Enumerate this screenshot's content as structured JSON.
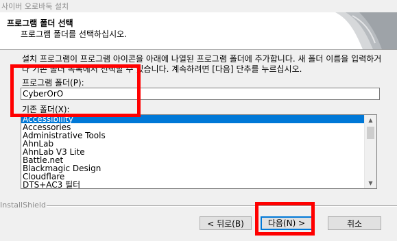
{
  "window": {
    "title": "사이버 오로바둑 설치"
  },
  "header": {
    "title": "프로그램 폴더 선택",
    "subtitle": "프로그램 폴더를 선택하십시오."
  },
  "description": "설치 프로그램이 프로그램 아이콘을 아래에 나열된 프로그램 폴더에 추가합니다. 새 폴더 이름을 입력하거나 기존 폴더 목록에서 선택할 수 있습니다. 계속하려면 [다음] 단추를 누르십시오.",
  "program_folder": {
    "label": "프로그램 폴더(P):",
    "value": "CyberOrO"
  },
  "existing_folders": {
    "label": "기존 폴더(X):",
    "items": [
      "Accessibility",
      "Accessories",
      "Administrative Tools",
      "AhnLab",
      "AhnLab V3 Lite",
      "Battle.net",
      "Blackmagic Design",
      "Cloudflare",
      "DTS+AC3 필터"
    ],
    "selected": "Accessibility"
  },
  "footer": {
    "brand": "InstallShield"
  },
  "buttons": {
    "back": "< 뒤로(B)",
    "next": "다음(N) >",
    "cancel": "취소"
  },
  "colors": {
    "highlight": "#ff0000",
    "selection": "#0078d7"
  },
  "icons": {
    "scroll_up": "scroll-up-arrow-icon",
    "scroll_down": "scroll-down-arrow-icon"
  }
}
